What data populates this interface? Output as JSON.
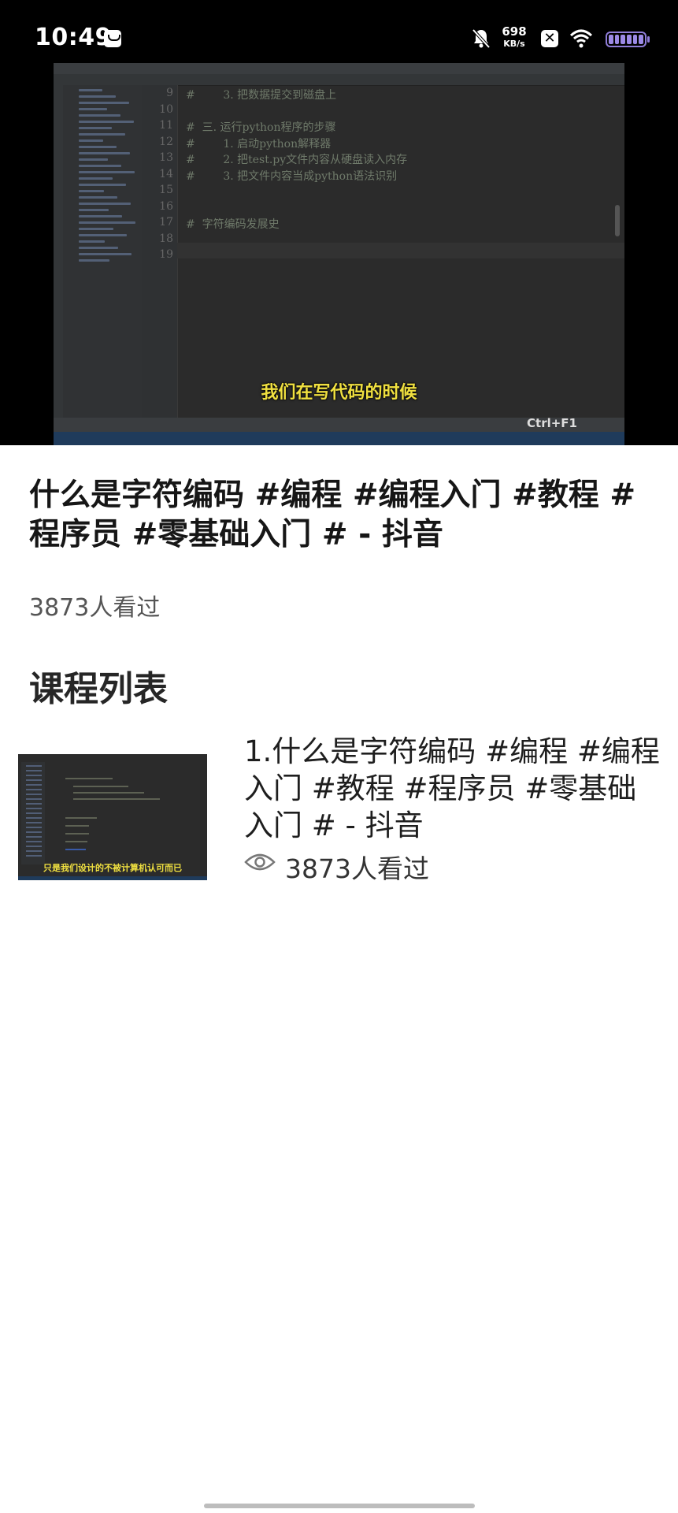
{
  "status_bar": {
    "time": "10:49",
    "net_speed_value": "698",
    "net_speed_unit": "KB/s",
    "icons": [
      "notification-icon",
      "mute-icon",
      "x-icon",
      "wifi-icon",
      "battery-icon"
    ]
  },
  "video": {
    "subtitle": "我们在写代码的时候",
    "shortcut_hint": "Ctrl+F1",
    "code_lines": [
      {
        "no": "9",
        "text": "#        3. 把数据提交到磁盘上"
      },
      {
        "no": "10",
        "text": ""
      },
      {
        "no": "11",
        "text": "#  三. 运行python程序的步骤"
      },
      {
        "no": "12",
        "text": "#        1. 启动python解释器"
      },
      {
        "no": "13",
        "text": "#        2. 把test.py文件内容从硬盘读入内存"
      },
      {
        "no": "14",
        "text": "#        3. 把文件内容当成python语法识别"
      },
      {
        "no": "15",
        "text": ""
      },
      {
        "no": "16",
        "text": ""
      },
      {
        "no": "17",
        "text": "#  字符编码发展史"
      },
      {
        "no": "18",
        "text": ""
      },
      {
        "no": "19",
        "text": ""
      }
    ]
  },
  "main": {
    "title": "什么是字符编码 #编程 #编程入门 #教程 #程序员 #零基础入门 # - 抖音",
    "view_count": "3873人看过",
    "section_heading": "课程列表"
  },
  "course_list": [
    {
      "title": "1.什么是字符编码 #编程 #编程入门 #教程 #程序员 #零基础入门 # - 抖音",
      "views": "3873人看过",
      "thumb_subtitle": "只是我们设计的不被计算机认可而已"
    }
  ]
}
